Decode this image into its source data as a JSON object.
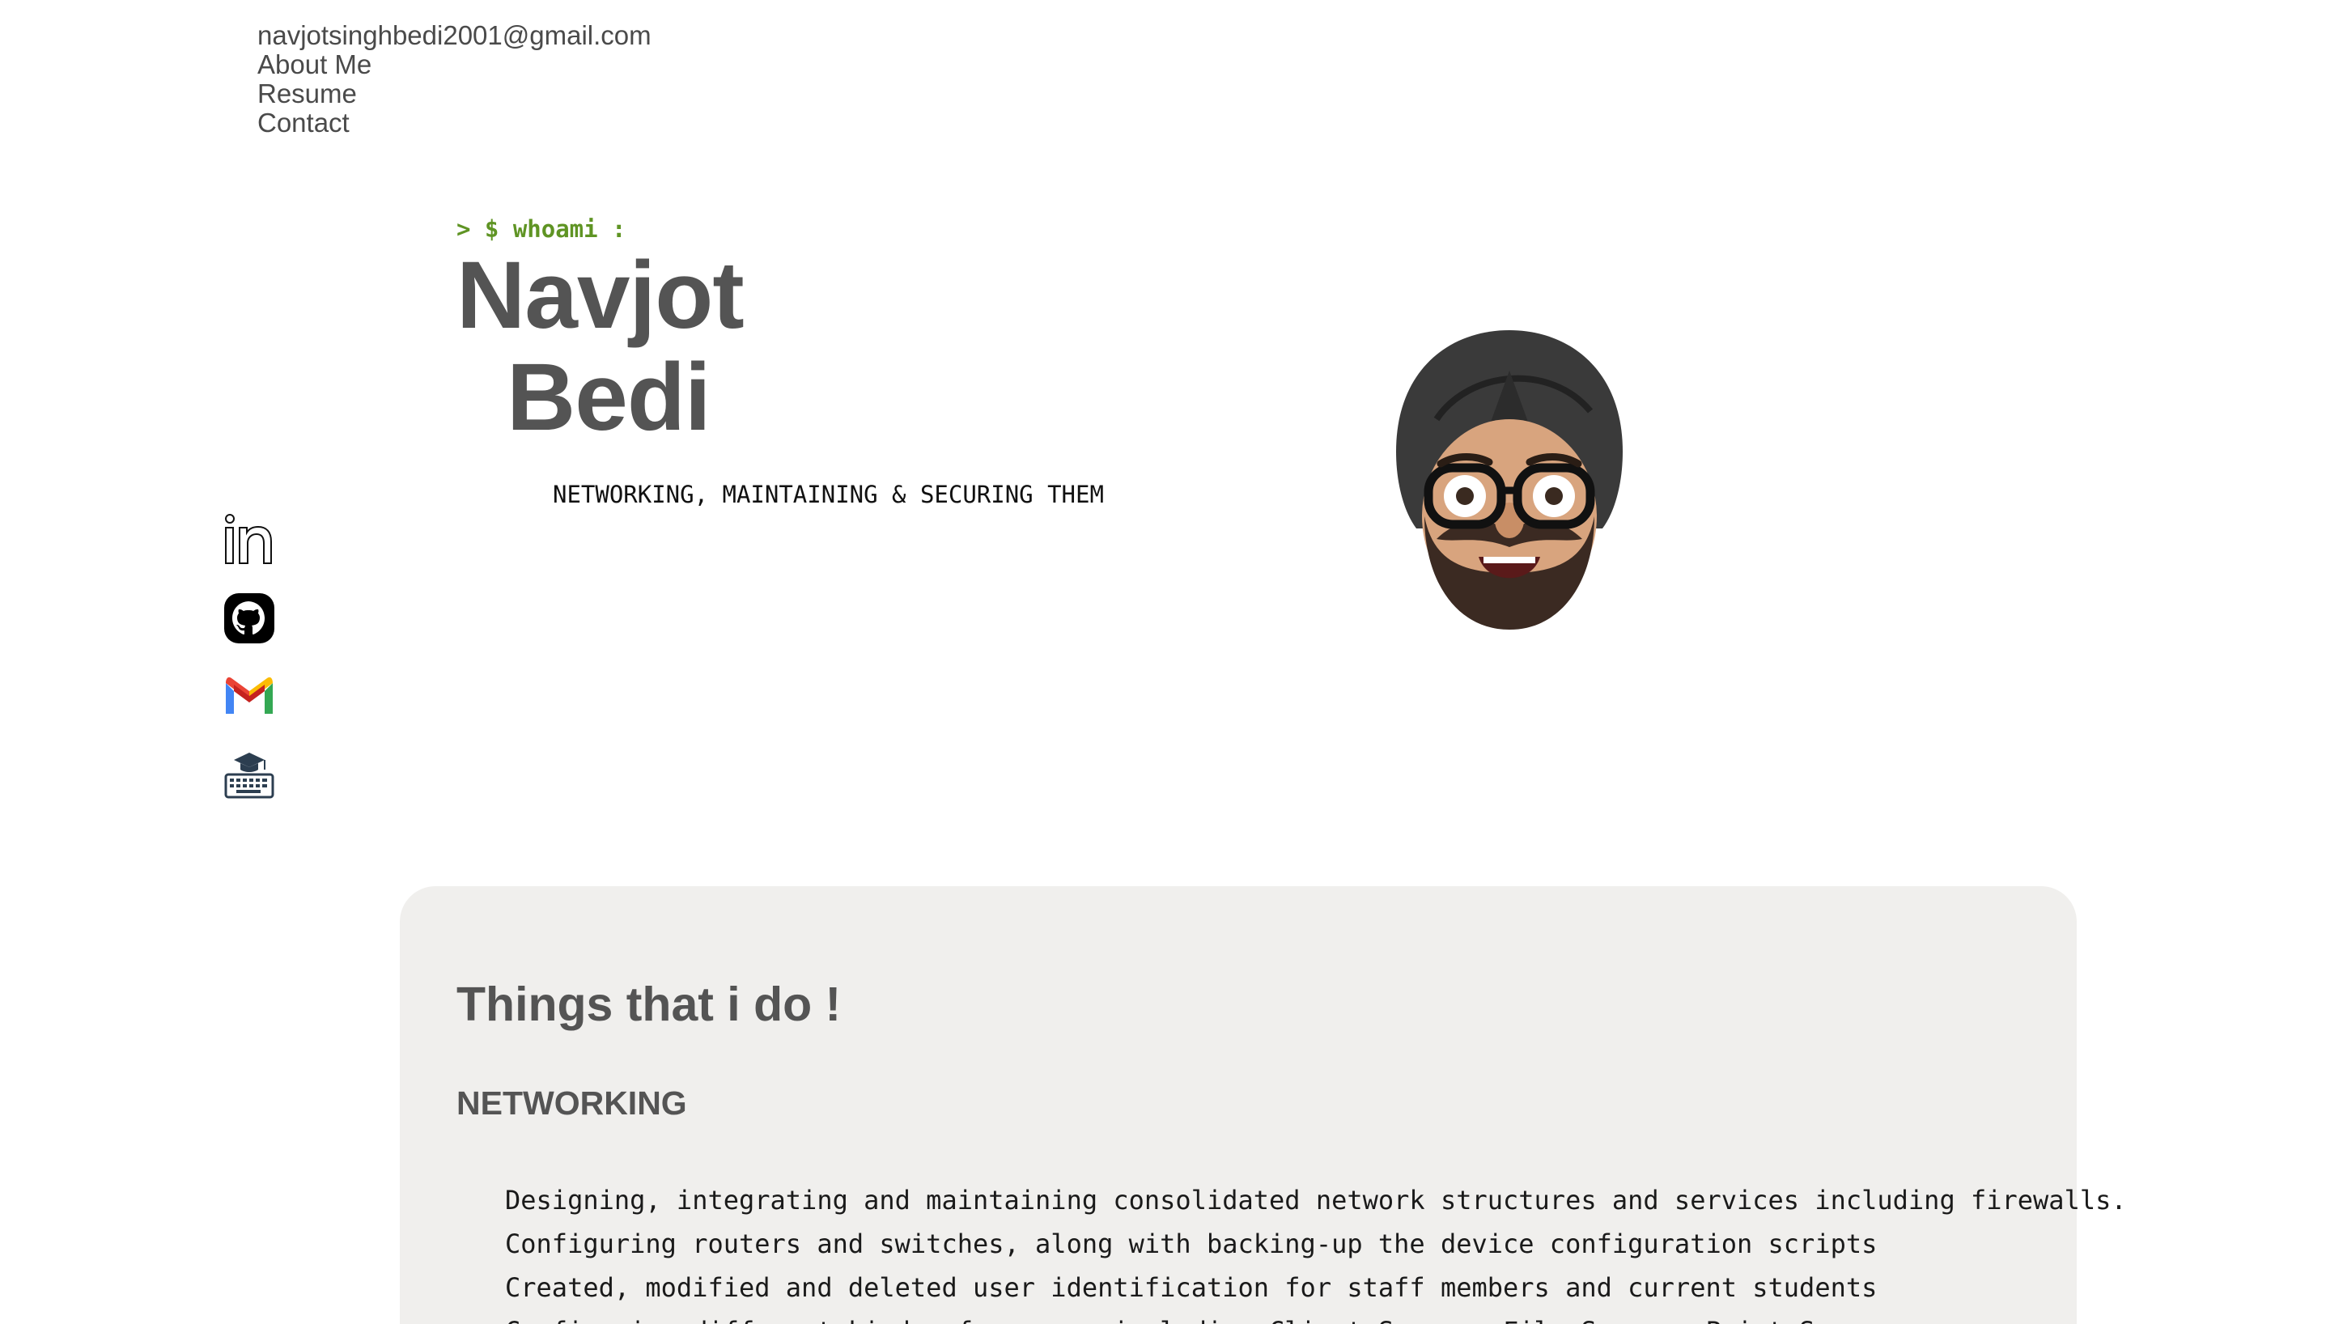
{
  "nav": {
    "email": "navjotsinghbedi2001@gmail.com",
    "links": [
      "About Me",
      "Resume",
      "Contact"
    ]
  },
  "social": [
    {
      "name": "LinkedIn",
      "icon": "linkedin-icon"
    },
    {
      "name": "GitHub",
      "icon": "github-icon"
    },
    {
      "name": "Gmail",
      "icon": "gmail-icon"
    },
    {
      "name": "Learning",
      "icon": "keyboard-graduation-icon"
    }
  ],
  "hero": {
    "prompt": "> $ whoami :",
    "first_name": "Navjot",
    "last_name": "Bedi",
    "tagline": "NETWORKING, MAINTAINING & SECURING THEM",
    "avatar": "memoji-avatar"
  },
  "colors": {
    "prompt": "#5f9424",
    "heading": "#545454",
    "card_bg": "#f0efed"
  },
  "things": {
    "title": "Things that i do !",
    "section": "NETWORKING",
    "items": [
      "Designing, integrating and maintaining consolidated network structures and services including firewalls.",
      "Configuring routers and switches, along with backing-up the device configuration scripts",
      "Created, modified and deleted user identification for staff members and current students",
      "Configuring different kinds of servers including Client Server, File Server, Print Server"
    ]
  }
}
